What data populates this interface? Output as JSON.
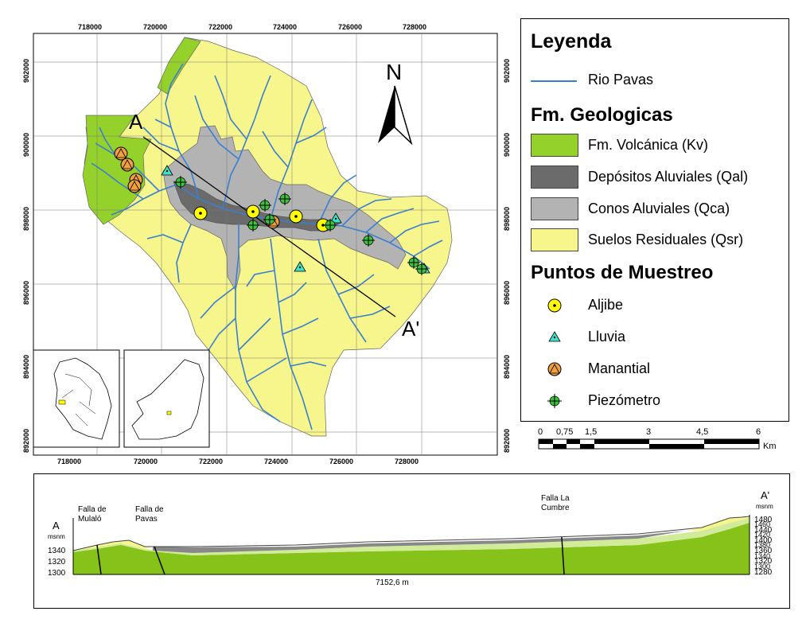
{
  "map": {
    "top_x_ticks": [
      "718000",
      "720000",
      "722000",
      "724000",
      "726000",
      "728000"
    ],
    "bottom_x_ticks": [
      "718000",
      "720000",
      "722000",
      "724000",
      "726000",
      "728000"
    ],
    "left_y_ticks": [
      "902000",
      "900000",
      "898000",
      "896000",
      "894000",
      "892000"
    ],
    "right_y_ticks": [
      "902000",
      "900000",
      "898000",
      "896000",
      "894000",
      "892000"
    ],
    "north_label": "N",
    "section_start_label": "A",
    "section_end_label": "A'"
  },
  "legend": {
    "title": "Leyenda",
    "river_label": "Rio Pavas",
    "formations_heading": "Fm. Geologicas",
    "formations": [
      {
        "label": "Fm. Volcánica (Kv)",
        "color": "#95d12b"
      },
      {
        "label": "Depósitos Aluviales (Qal)",
        "color": "#6b6b6b"
      },
      {
        "label": "Conos Aluviales (Qca)",
        "color": "#b3b3b3"
      },
      {
        "label": "Suelos Residuales (Qsr)",
        "color": "#f6f68c"
      }
    ],
    "sampling_heading": "Puntos de Muestreo",
    "sampling": [
      {
        "label": "Aljibe",
        "icon": "aljibe-circle-icon",
        "color": "#ffff00"
      },
      {
        "label": "Lluvia",
        "icon": "lluvia-triangle-icon",
        "color": "#40e0c8"
      },
      {
        "label": "Manantial",
        "icon": "manantial-circle-triangle-icon",
        "color": "#f0a040"
      },
      {
        "label": "Piezómetro",
        "icon": "piezometro-cross-circle-icon",
        "color": "#40c040"
      }
    ]
  },
  "scale_bar": {
    "ticks": [
      "0",
      "0,75",
      "1,5",
      "3",
      "4,5",
      "6"
    ],
    "unit": "Km"
  },
  "cross_section": {
    "start_label": "A",
    "end_label": "A'",
    "left_unit": "msnm",
    "right_unit": "msnm",
    "left_elevations": [
      "1340",
      "1320",
      "1300"
    ],
    "right_elevations": [
      "1480",
      "1460",
      "1440",
      "1420",
      "1400",
      "1380",
      "1360",
      "1340",
      "1320",
      "1300",
      "1280"
    ],
    "faults": [
      "Falla de Mulaló",
      "Falla de Pavas",
      "Falla La Cumbre"
    ],
    "length_label": "7152,6 m"
  }
}
